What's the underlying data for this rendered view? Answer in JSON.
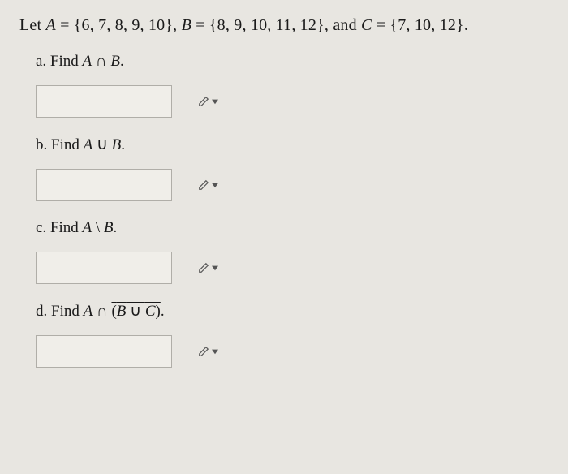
{
  "problem": {
    "prefix": "Let ",
    "A_label": "A",
    "eq1": " = {6, 7, 8, 9, 10}, ",
    "B_label": "B",
    "eq2": " = {8, 9, 10, 11, 12}, and ",
    "C_label": "C",
    "eq3": " = {7, 10, 12}."
  },
  "parts": {
    "a": {
      "label": "a. Find ",
      "expr_A": "A",
      "expr_op": " ∩ ",
      "expr_B": "B",
      "expr_suffix": ".",
      "value": ""
    },
    "b": {
      "label": "b. Find ",
      "expr_A": "A",
      "expr_op": " ∪ ",
      "expr_B": "B",
      "expr_suffix": ".",
      "value": ""
    },
    "c": {
      "label": "c. Find ",
      "expr_A": "A",
      "expr_op": " \\ ",
      "expr_B": "B",
      "expr_suffix": ".",
      "value": ""
    },
    "d": {
      "label": "d. Find ",
      "expr_A": "A",
      "expr_op": " ∩ ",
      "expr_over_open": "(",
      "expr_B": "B",
      "expr_union": " ∪ ",
      "expr_C": "C",
      "expr_over_close": ")",
      "expr_suffix": ".",
      "value": ""
    }
  }
}
